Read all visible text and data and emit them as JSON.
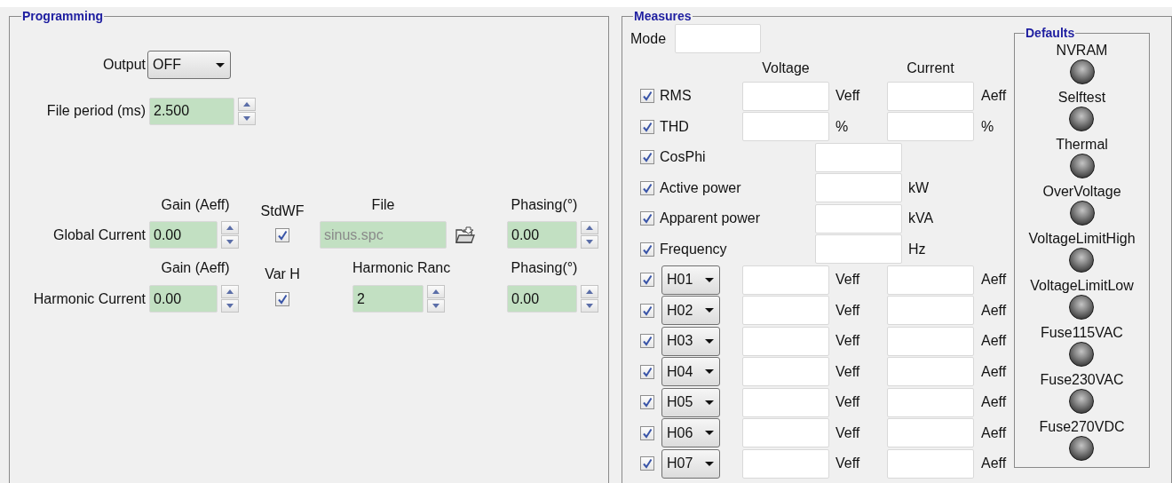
{
  "programming": {
    "title": "Programming",
    "output": {
      "label": "Output",
      "value": "OFF"
    },
    "file_period": {
      "label": "File period (ms)",
      "value": "2.500"
    },
    "current_rows": [
      {
        "kind": "file",
        "label": "Global Current",
        "gain_header": "Gain (Aeff)",
        "gain": "0.00",
        "check_header": "StdWF",
        "checked": true,
        "file_header": "File",
        "file": "sinus.spc",
        "disabled": true,
        "phasing_header": "Phasing(°)",
        "phasing": "0.00"
      },
      {
        "kind": "range",
        "label": "Harmonic Current",
        "gain_header": "Gain (Aeff)",
        "gain": "0.00",
        "check_header": "Var H",
        "checked": true,
        "range_header": "Harmonic Ranc",
        "range": "2",
        "phasing_header": "Phasing(°)",
        "phasing": "0.00"
      }
    ]
  },
  "measures": {
    "title": "Measures",
    "mode_label": "Mode",
    "column_headers": [
      "Voltage",
      "Current"
    ],
    "rows": [
      {
        "kind": "dual",
        "label": "RMS",
        "checked": true,
        "voltage_unit": "Veff",
        "current_unit": "Aeff"
      },
      {
        "kind": "dual",
        "label": "THD",
        "checked": true,
        "voltage_unit": "%",
        "current_unit": "%"
      },
      {
        "kind": "single",
        "label": "CosPhi",
        "checked": true
      },
      {
        "kind": "single",
        "label": "Active power",
        "checked": true,
        "unit": "kW"
      },
      {
        "kind": "single",
        "label": "Apparent power",
        "checked": true,
        "unit": "kVA"
      },
      {
        "kind": "single",
        "label": "Frequency",
        "checked": true,
        "unit": "Hz"
      },
      {
        "kind": "harmonic",
        "harmonic": "H01",
        "checked": true,
        "voltage_unit": "Veff",
        "current_unit": "Aeff"
      },
      {
        "kind": "harmonic",
        "harmonic": "H02",
        "checked": true,
        "voltage_unit": "Veff",
        "current_unit": "Aeff"
      },
      {
        "kind": "harmonic",
        "harmonic": "H03",
        "checked": true,
        "voltage_unit": "Veff",
        "current_unit": "Aeff"
      },
      {
        "kind": "harmonic",
        "harmonic": "H04",
        "checked": true,
        "voltage_unit": "Veff",
        "current_unit": "Aeff"
      },
      {
        "kind": "harmonic",
        "harmonic": "H05",
        "checked": true,
        "voltage_unit": "Veff",
        "current_unit": "Aeff"
      },
      {
        "kind": "harmonic",
        "harmonic": "H06",
        "checked": true,
        "voltage_unit": "Veff",
        "current_unit": "Aeff"
      },
      {
        "kind": "harmonic",
        "harmonic": "H07",
        "checked": true,
        "voltage_unit": "Veff",
        "current_unit": "Aeff"
      }
    ]
  },
  "defaults": {
    "title": "Defaults",
    "indicators": [
      {
        "label": "NVRAM",
        "on": false
      },
      {
        "label": "Selftest",
        "on": false
      },
      {
        "label": "Thermal",
        "on": false
      },
      {
        "label": "OverVoltage",
        "on": false
      },
      {
        "label": "VoltageLimitHigh",
        "on": false
      },
      {
        "label": "VoltageLimitLow",
        "on": false
      },
      {
        "label": "Fuse115VAC",
        "on": false
      },
      {
        "label": "Fuse230VAC",
        "on": false
      },
      {
        "label": "Fuse270VDC",
        "on": false
      }
    ]
  }
}
